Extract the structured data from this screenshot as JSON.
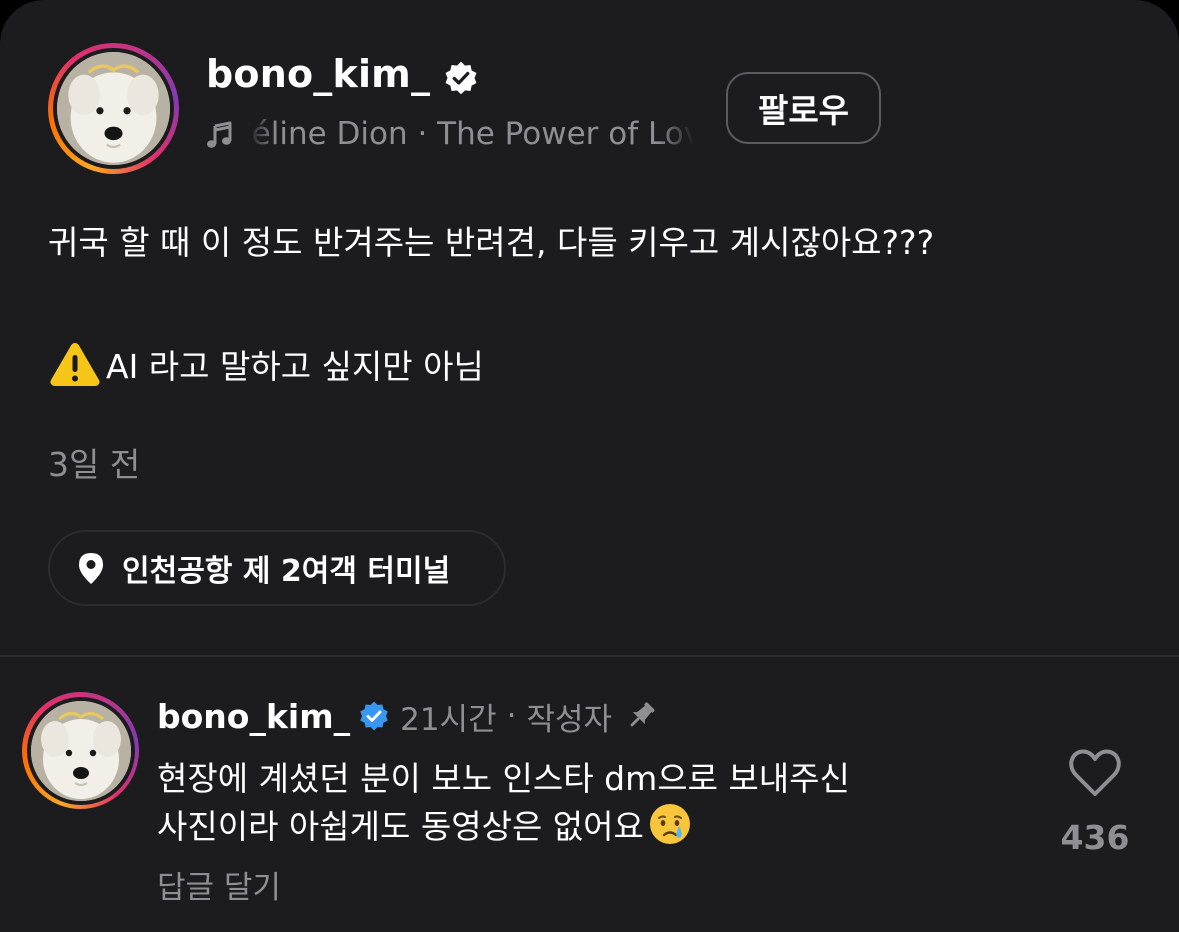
{
  "post": {
    "username": "bono_kim_",
    "verified": true,
    "music": "Céline Dion · The Power of Love",
    "follow_label": "팔로우",
    "caption_line1": "귀국 할 때 이 정도 반겨주는 반려견, 다들 키우고 계시잖아요???",
    "caption_line2": "AI 라고 말하고 싶지만 아님",
    "time": "3일 전",
    "location": "인천공항 제 2여객 터미널"
  },
  "comment": {
    "username": "bono_kim_",
    "verified": true,
    "time": "21시간",
    "separator": "·",
    "author_tag": "작성자",
    "text_line1": "현장에 계셨던 분이 보노 인스타 dm으로 보내주신",
    "text_line2": "사진이라 아쉽게도 동영상은 없어요",
    "reply_label": "답글 달기",
    "like_count": "436"
  },
  "icons": {
    "verified": "verified-badge-icon",
    "music": "music-note-icon",
    "warning": "warning-emoji-icon",
    "location": "location-pin-icon",
    "pin": "pushpin-icon",
    "cry": "crying-face-emoji-icon",
    "like": "heart-outline-icon"
  },
  "colors": {
    "background": "#1c1c1e",
    "text_primary": "#ffffff",
    "text_secondary": "#8e8e93",
    "verified_blue": "#3897f0",
    "border": "#2c2c2e"
  }
}
